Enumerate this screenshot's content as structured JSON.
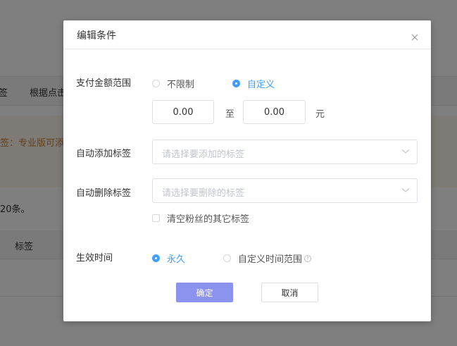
{
  "background": {
    "tabs": [
      "签",
      "根据点击"
    ],
    "notice_text": "签：专业版可添加",
    "count_text": "20条。",
    "table_header": "标签"
  },
  "modal": {
    "title": "编辑条件",
    "pay_range": {
      "label": "支付金额范围",
      "options": [
        "不限制",
        "自定义"
      ],
      "selected": "自定义",
      "min_value": "0.00",
      "to_label": "至",
      "max_value": "0.00",
      "unit": "元"
    },
    "auto_add_tag": {
      "label": "自动添加标签",
      "placeholder": "请选择要添加的标签"
    },
    "auto_remove_tag": {
      "label": "自动删除标签",
      "placeholder": "请选择要删除的标签",
      "clear_checkbox_label": "清空粉丝的其它标签",
      "clear_checked": false
    },
    "effective_time": {
      "label": "生效时间",
      "options": [
        "永久",
        "自定义时间范围"
      ],
      "selected": "永久",
      "help_icon": "?"
    },
    "buttons": {
      "confirm": "确定",
      "cancel": "取消"
    }
  },
  "colors": {
    "accent": "#409eff",
    "primary_button": "#8c93ee",
    "overlay": "rgba(0,0,0,0.5)"
  }
}
